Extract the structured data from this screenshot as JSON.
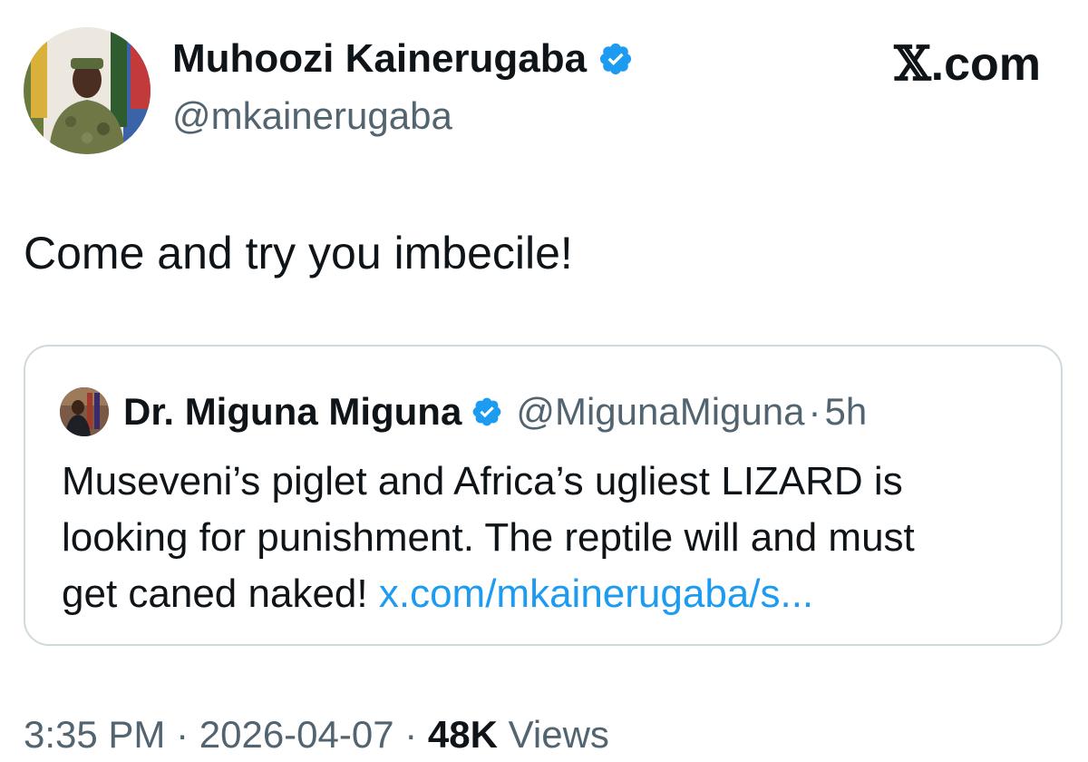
{
  "header": {
    "display_name": "Muhoozi Kainerugaba",
    "handle": "@mkainerugaba",
    "verified_icon": "verified-badge-icon",
    "brand_x": "𝕏",
    "brand_rest": ".com"
  },
  "tweet": {
    "text": "Come and try you imbecile!"
  },
  "quote": {
    "display_name": "Dr. Miguna Miguna",
    "handle": "@MigunaMiguna",
    "dot": "·",
    "time": "5h",
    "line1": "Museveni’s piglet and Africa’s ugliest LIZARD is",
    "line2": "looking for punishment. The reptile will and must",
    "line3_text": "get caned naked! ",
    "link": "x.com/mkainerugaba/s..."
  },
  "meta": {
    "time": "3:35 PM",
    "sep1": " · ",
    "date": "2026-04-07",
    "sep2": " · ",
    "views_count": "48K",
    "views_label": " Views"
  },
  "colors": {
    "verified": "#1d9bf0",
    "link": "#1d9bf0",
    "secondary_text": "#536471",
    "border": "#cfd9de"
  }
}
